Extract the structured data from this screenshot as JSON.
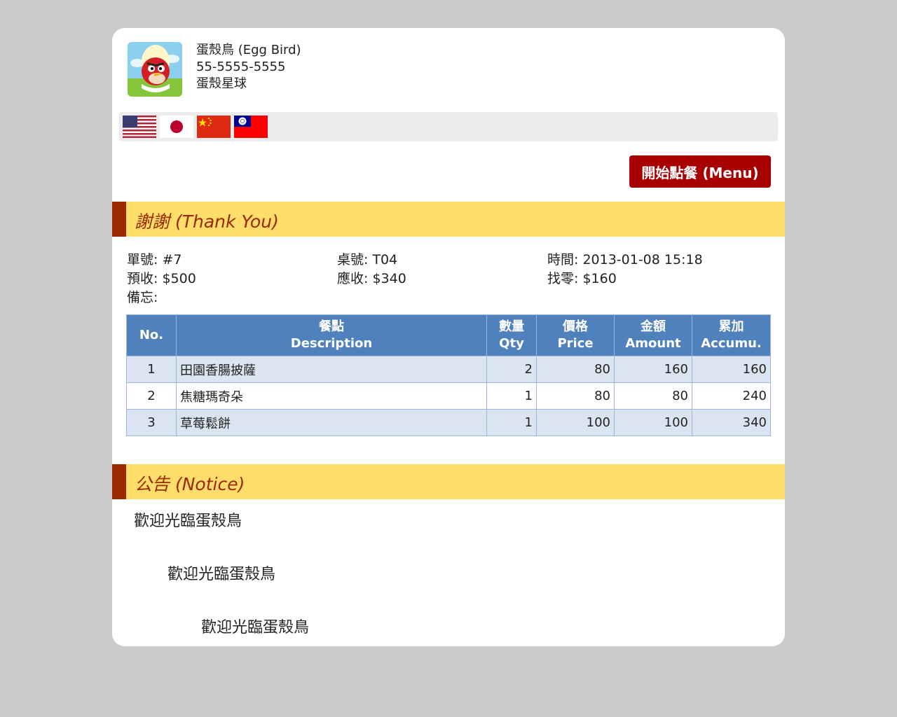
{
  "shop": {
    "name": "蛋殼鳥 (Egg Bird)",
    "phone": "55-5555-5555",
    "address": "蛋殼星球",
    "logo_icon": "angry-bird-egg-logo"
  },
  "languages": [
    {
      "code": "en",
      "icon": "us-flag-icon"
    },
    {
      "code": "ja",
      "icon": "japan-flag-icon"
    },
    {
      "code": "zh-cn",
      "icon": "china-flag-icon"
    },
    {
      "code": "zh-tw",
      "icon": "taiwan-flag-icon"
    }
  ],
  "menu_button": "開始點餐 (Menu)",
  "thanks_title": "謝謝 (Thank You)",
  "order": {
    "number": "單號: #7",
    "table": "桌號: T04",
    "time": "時間: 2013-01-08 15:18",
    "prepaid": "預收: $500",
    "due": "應收: $340",
    "change": "找零: $160",
    "memo": "備忘:"
  },
  "table_headers": {
    "no": "No.",
    "desc_zh": "餐點",
    "desc_en": "Description",
    "qty_zh": "數量",
    "qty_en": "Qty",
    "price_zh": "價格",
    "price_en": "Price",
    "amount_zh": "金額",
    "amount_en": "Amount",
    "accum_zh": "累加",
    "accum_en": "Accumu."
  },
  "items": [
    {
      "no": "1",
      "desc": "田園香腸披薩",
      "qty": "2",
      "price": "80",
      "amount": "160",
      "accum": "160"
    },
    {
      "no": "2",
      "desc": "焦糖瑪奇朵",
      "qty": "1",
      "price": "80",
      "amount": "80",
      "accum": "240"
    },
    {
      "no": "3",
      "desc": "草莓鬆餅",
      "qty": "1",
      "price": "100",
      "amount": "100",
      "accum": "340"
    }
  ],
  "notice_title": "公告 (Notice)",
  "notice_lines": [
    "歡迎光臨蛋殼鳥",
    "歡迎光臨蛋殼鳥",
    "歡迎光臨蛋殼鳥"
  ],
  "colors": {
    "accent_red": "#a80000",
    "section_bg": "#ffdd6b",
    "section_text": "#9c2800",
    "table_header": "#4f81bd",
    "table_row_alt": "#dbe5f1"
  }
}
